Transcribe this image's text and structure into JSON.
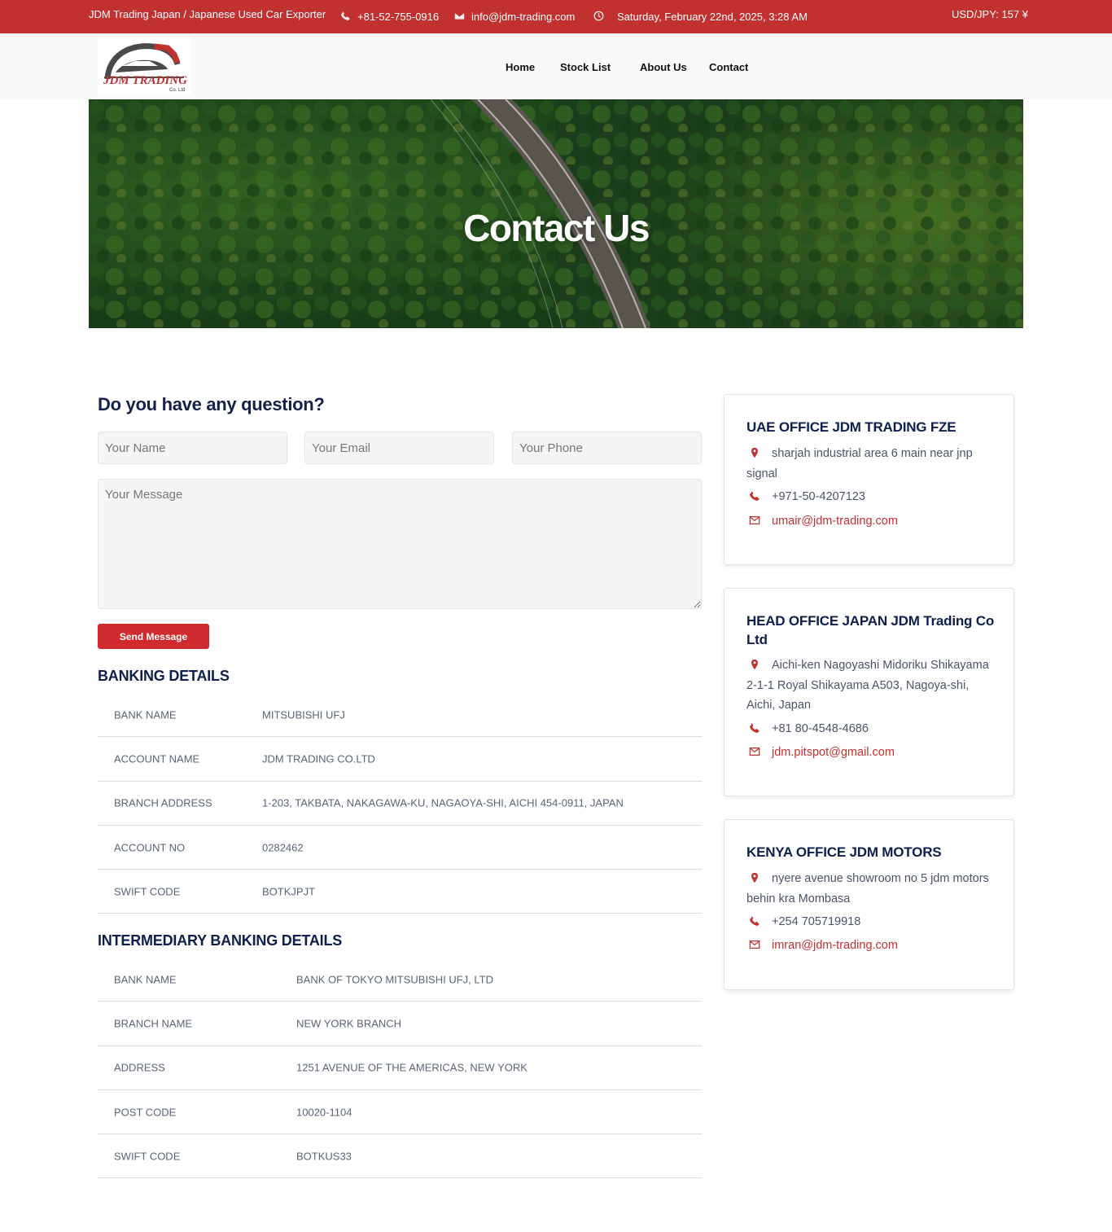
{
  "topbar": {
    "brand": "JDM Trading Japan / Japanese Used Car Exporter",
    "phone": "+81-52-755-0916",
    "email": "info@jdm-trading.com",
    "datetime": "Saturday, February 22nd, 2025, 3:28 AM",
    "exchange": "USD/JPY: 157 ¥"
  },
  "logo": {
    "text": "JDM TRADING",
    "subtext": "Co. Ltd"
  },
  "nav": {
    "home": "Home",
    "stock": "Stock List",
    "about": "About Us",
    "contact": "Contact"
  },
  "hero": {
    "title": "Contact Us"
  },
  "form": {
    "title": "Do you have any question?",
    "name_placeholder": "Your Name",
    "email_placeholder": "Your Email",
    "phone_placeholder": "Your Phone",
    "message_placeholder": "Your Message",
    "send_label": "Send Message"
  },
  "banking": {
    "title": "BANKING DETAILS",
    "rows": [
      {
        "k": "BANK NAME",
        "v": "MITSUBISHI UFJ"
      },
      {
        "k": "ACCOUNT NAME",
        "v": "JDM TRADING CO.LTD"
      },
      {
        "k": "BRANCH ADDRESS",
        "v": "1-203, TAKBATA, NAKAGAWA-KU, NAGAOYA-SHI, AICHI 454-0911, JAPAN"
      },
      {
        "k": "ACCOUNT NO",
        "v": "0282462"
      },
      {
        "k": "SWIFT CODE",
        "v": "BOTKJPJT"
      }
    ]
  },
  "intermediary": {
    "title": "INTERMEDIARY BANKING DETAILS",
    "rows": [
      {
        "k": "BANK NAME",
        "v": "BANK OF TOKYO MITSUBISHI UFJ, LTD"
      },
      {
        "k": "BRANCH NAME",
        "v": "NEW YORK BRANCH"
      },
      {
        "k": "ADDRESS",
        "v": "1251 AVENUE OF THE AMERICAS, NEW YORK"
      },
      {
        "k": "POST CODE",
        "v": "10020-1104"
      },
      {
        "k": "SWIFT CODE",
        "v": "BOTKUS33"
      }
    ]
  },
  "offices": [
    {
      "title": "UAE OFFICE JDM TRADING FZE",
      "address": "sharjah industrial area 6 main near jnp signal",
      "phone": "+971-50-4207123",
      "email": "umair@jdm-trading.com"
    },
    {
      "title": "HEAD OFFICE JAPAN JDM Trading Co Ltd",
      "address": "Aichi-ken Nagoyashi Midoriku Shikayama 2-1-1 Royal Shikayama A503, Nagoya-shi, Aichi, Japan",
      "phone": "+81 80-4548-4686",
      "email": "jdm.pitspot@gmail.com"
    },
    {
      "title": "KENYA OFFICE JDM MOTORS",
      "address": "nyere avenue showroom no 5 jdm motors behin kra Mombasa",
      "phone": "+254 705719918",
      "email": "imran@jdm-trading.com"
    }
  ],
  "colors": {
    "brand_red": "#c0312f",
    "button_red": "#cf2a2e",
    "navy": "#0e1f4d"
  },
  "icons": [
    "phone-icon",
    "mail-icon",
    "clock-icon",
    "map-pin-icon"
  ]
}
